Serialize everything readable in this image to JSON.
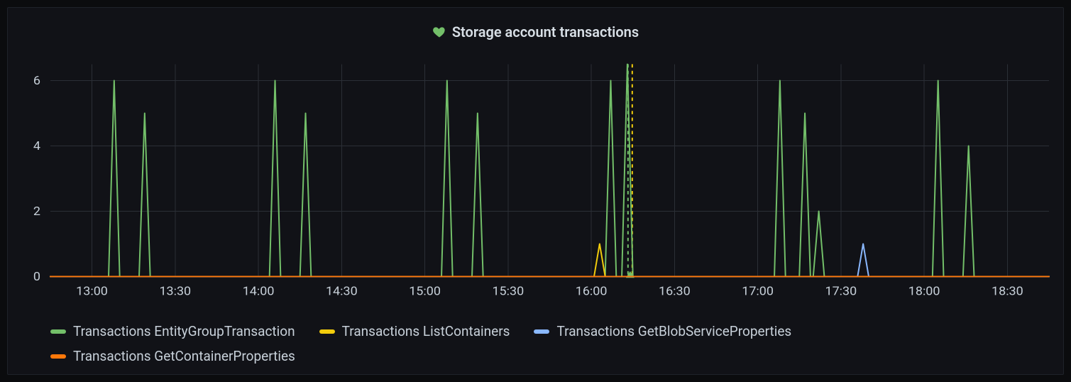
{
  "title": "Storage account transactions",
  "title_icon": "heart-icon",
  "colors": {
    "green": "#73BF69",
    "yellow": "#F2CC0C",
    "blue": "#8AB8FF",
    "orange": "#FF780A",
    "grid": "#2b2f36",
    "tick": "#c7d0d9"
  },
  "chart_data": {
    "type": "line",
    "title": "Storage account transactions",
    "xlabel": "",
    "ylabel": "",
    "ylim": [
      0,
      6.5
    ],
    "y_ticks": [
      0,
      2,
      4,
      6
    ],
    "x_ticks": [
      "13:00",
      "13:30",
      "14:00",
      "14:30",
      "15:00",
      "15:30",
      "16:00",
      "16:30",
      "17:00",
      "17:30",
      "18:00",
      "18:30"
    ],
    "x_range_minutes": [
      765,
      1125
    ],
    "annotation_marker": {
      "time": "16:14",
      "minutes": 974,
      "color_a": "#73BF69",
      "color_b": "#F2CC0C"
    },
    "series": [
      {
        "name": "Transactions EntityGroupTransaction",
        "color": "#73BF69",
        "points": [
          {
            "t": 765,
            "v": 0
          },
          {
            "t": 786,
            "v": 0
          },
          {
            "t": 788,
            "v": 6
          },
          {
            "t": 790,
            "v": 0
          },
          {
            "t": 797,
            "v": 0
          },
          {
            "t": 799,
            "v": 5
          },
          {
            "t": 801,
            "v": 0
          },
          {
            "t": 844,
            "v": 0
          },
          {
            "t": 846,
            "v": 6
          },
          {
            "t": 848,
            "v": 0
          },
          {
            "t": 855,
            "v": 0
          },
          {
            "t": 857,
            "v": 5
          },
          {
            "t": 859,
            "v": 0
          },
          {
            "t": 906,
            "v": 0
          },
          {
            "t": 908,
            "v": 6
          },
          {
            "t": 910,
            "v": 0
          },
          {
            "t": 917,
            "v": 0
          },
          {
            "t": 919,
            "v": 5
          },
          {
            "t": 921,
            "v": 0
          },
          {
            "t": 965,
            "v": 0
          },
          {
            "t": 967,
            "v": 6
          },
          {
            "t": 969,
            "v": 0
          },
          {
            "t": 971,
            "v": 0
          },
          {
            "t": 973,
            "v": 6.5
          },
          {
            "t": 975,
            "v": 0
          },
          {
            "t": 1026,
            "v": 0
          },
          {
            "t": 1028,
            "v": 6
          },
          {
            "t": 1030,
            "v": 0
          },
          {
            "t": 1035,
            "v": 0
          },
          {
            "t": 1037,
            "v": 5
          },
          {
            "t": 1039,
            "v": 0
          },
          {
            "t": 1040,
            "v": 0
          },
          {
            "t": 1042,
            "v": 2
          },
          {
            "t": 1044,
            "v": 0
          },
          {
            "t": 1083,
            "v": 0
          },
          {
            "t": 1085,
            "v": 6
          },
          {
            "t": 1087,
            "v": 0
          },
          {
            "t": 1094,
            "v": 0
          },
          {
            "t": 1096,
            "v": 4
          },
          {
            "t": 1098,
            "v": 0
          },
          {
            "t": 1125,
            "v": 0
          }
        ]
      },
      {
        "name": "Transactions ListContainers",
        "color": "#F2CC0C",
        "points": [
          {
            "t": 765,
            "v": 0
          },
          {
            "t": 961,
            "v": 0
          },
          {
            "t": 963,
            "v": 1
          },
          {
            "t": 965,
            "v": 0
          },
          {
            "t": 1125,
            "v": 0
          }
        ]
      },
      {
        "name": "Transactions GetBlobServiceProperties",
        "color": "#8AB8FF",
        "points": [
          {
            "t": 765,
            "v": 0
          },
          {
            "t": 1056,
            "v": 0
          },
          {
            "t": 1058,
            "v": 1
          },
          {
            "t": 1060,
            "v": 0
          },
          {
            "t": 1125,
            "v": 0
          }
        ]
      },
      {
        "name": "Transactions GetContainerProperties",
        "color": "#FF780A",
        "points": [
          {
            "t": 765,
            "v": 0
          },
          {
            "t": 1125,
            "v": 0
          }
        ]
      }
    ],
    "legend": [
      "Transactions EntityGroupTransaction",
      "Transactions ListContainers",
      "Transactions GetBlobServiceProperties",
      "Transactions GetContainerProperties"
    ]
  }
}
